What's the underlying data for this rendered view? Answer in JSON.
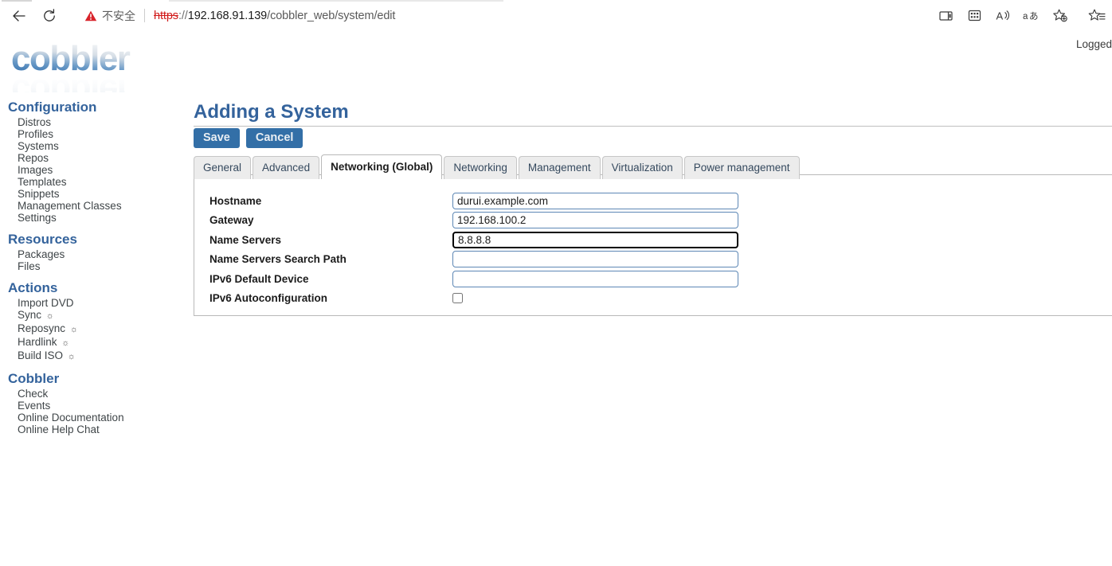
{
  "browser": {
    "back_icon": "back-arrow-icon",
    "reload_icon": "reload-icon",
    "security": {
      "icon": "warning-triangle-icon",
      "label": "不安全"
    },
    "url": {
      "scheme": "https",
      "separator": "://",
      "host": "192.168.91.139",
      "path": "/cobbler_web/system/edit",
      "full": "https://192.168.91.139/cobbler_web/system/edit"
    },
    "toolbar_icons": [
      {
        "name": "split-screen-icon",
        "glyph": "⬜"
      },
      {
        "name": "collections-icon",
        "glyph": "⬛"
      },
      {
        "name": "read-aloud-icon",
        "glyph": "A"
      },
      {
        "name": "translate-icon",
        "glyph": "aあ"
      },
      {
        "name": "add-favorite-icon",
        "glyph": "☆"
      },
      {
        "name": "favorites-list-icon",
        "glyph": "☆"
      }
    ]
  },
  "app": {
    "logo_text": "cobbler",
    "logged_status": "Logged"
  },
  "sidebar": {
    "sections": [
      {
        "title": "Configuration",
        "items": [
          {
            "label": "Distros",
            "icon": ""
          },
          {
            "label": "Profiles",
            "icon": ""
          },
          {
            "label": "Systems",
            "icon": ""
          },
          {
            "label": "Repos",
            "icon": ""
          },
          {
            "label": "Images",
            "icon": ""
          },
          {
            "label": "Templates",
            "icon": ""
          },
          {
            "label": "Snippets",
            "icon": ""
          },
          {
            "label": "Management Classes",
            "icon": ""
          },
          {
            "label": "Settings",
            "icon": ""
          }
        ]
      },
      {
        "title": "Resources",
        "items": [
          {
            "label": "Packages",
            "icon": ""
          },
          {
            "label": "Files",
            "icon": ""
          }
        ]
      },
      {
        "title": "Actions",
        "items": [
          {
            "label": "Import DVD",
            "icon": ""
          },
          {
            "label": "Sync",
            "icon": "☼"
          },
          {
            "label": "Reposync",
            "icon": "☼"
          },
          {
            "label": "Hardlink",
            "icon": "☼"
          },
          {
            "label": "Build ISO",
            "icon": "☼"
          }
        ]
      },
      {
        "title": "Cobbler",
        "items": [
          {
            "label": "Check",
            "icon": ""
          },
          {
            "label": "Events",
            "icon": ""
          },
          {
            "label": "Online Documentation",
            "icon": ""
          },
          {
            "label": "Online Help Chat",
            "icon": ""
          }
        ]
      }
    ]
  },
  "main": {
    "page_title": "Adding a System",
    "buttons": {
      "save": "Save",
      "cancel": "Cancel"
    },
    "tabs": [
      {
        "label": "General",
        "active": false
      },
      {
        "label": "Advanced",
        "active": false
      },
      {
        "label": "Networking (Global)",
        "active": true
      },
      {
        "label": "Networking",
        "active": false
      },
      {
        "label": "Management",
        "active": false
      },
      {
        "label": "Virtualization",
        "active": false
      },
      {
        "label": "Power management",
        "active": false
      }
    ],
    "form": {
      "fields": [
        {
          "label": "Hostname",
          "type": "text",
          "value": "durui.example.com",
          "placeholder": "",
          "focused": false
        },
        {
          "label": "Gateway",
          "type": "text",
          "value": "192.168.100.2",
          "placeholder": "",
          "focused": false
        },
        {
          "label": "Name Servers",
          "type": "text",
          "value": "8.8.8.8",
          "placeholder": "",
          "focused": true
        },
        {
          "label": "Name Servers Search Path",
          "type": "text",
          "value": "",
          "placeholder": "",
          "focused": false
        },
        {
          "label": "IPv6 Default Device",
          "type": "text",
          "value": "",
          "placeholder": "",
          "focused": false
        },
        {
          "label": "IPv6 Autoconfiguration",
          "type": "checkbox",
          "value": "",
          "checked": false,
          "focused": false
        }
      ]
    }
  },
  "colors": {
    "accent_blue": "#34639c",
    "button_blue": "#336fa7",
    "input_border": "#5d87b5",
    "warning_red": "#d11b1b",
    "sidebar_text": "#3f4548"
  }
}
